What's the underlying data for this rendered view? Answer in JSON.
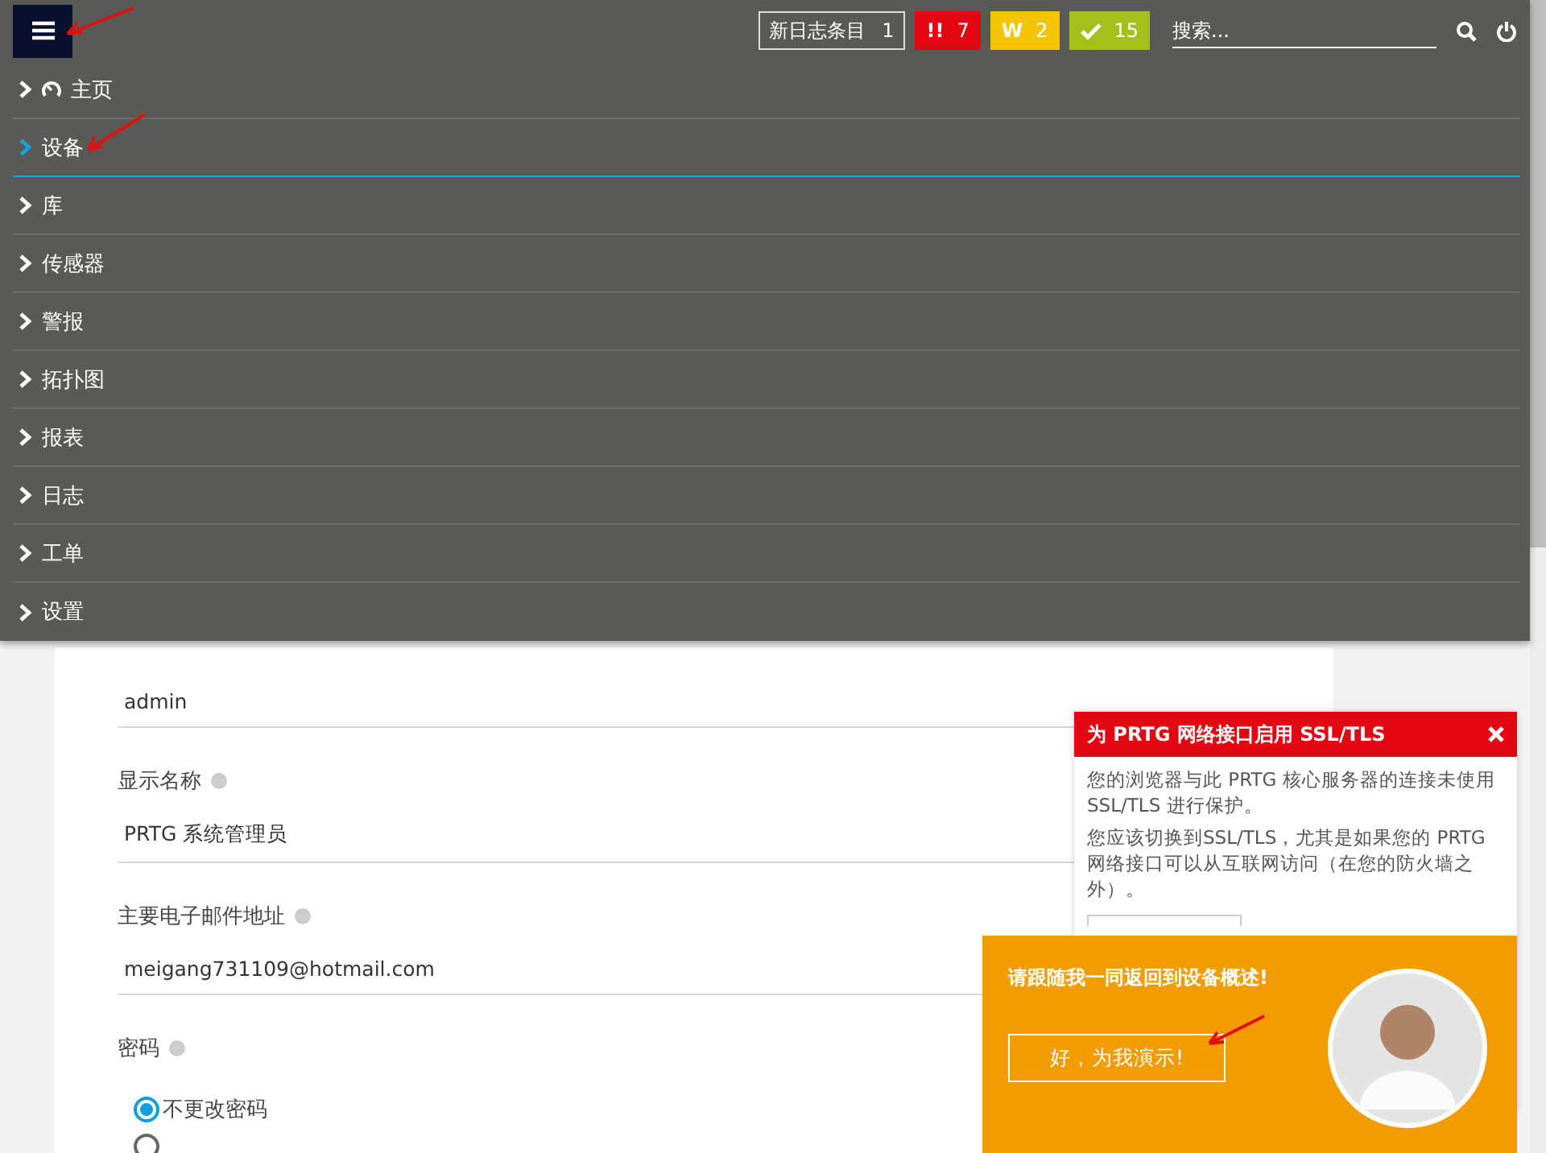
{
  "topbar": {
    "new_log": {
      "label": "新日志条目",
      "count": "1"
    },
    "alerts": [
      {
        "kind": "error",
        "symbol": "!!",
        "count": "7",
        "color": "#e30613"
      },
      {
        "kind": "warning",
        "symbol": "W",
        "count": "2",
        "color": "#f5c400"
      },
      {
        "kind": "ok",
        "count": "15",
        "color": "#a5bf1d"
      }
    ],
    "search": {
      "placeholder": "搜索..."
    }
  },
  "menu": {
    "items": [
      {
        "label": "主页",
        "kind": "home",
        "selected": false
      },
      {
        "label": "设备",
        "kind": "plain",
        "selected": true
      },
      {
        "label": "库",
        "kind": "plain",
        "selected": false
      },
      {
        "label": "传感器",
        "kind": "plain",
        "selected": false
      },
      {
        "label": "警报",
        "kind": "plain",
        "selected": false
      },
      {
        "label": "拓扑图",
        "kind": "plain",
        "selected": false
      },
      {
        "label": "报表",
        "kind": "plain",
        "selected": false
      },
      {
        "label": "日志",
        "kind": "plain",
        "selected": false
      },
      {
        "label": "工单",
        "kind": "plain",
        "selected": false
      },
      {
        "label": "设置",
        "kind": "plain",
        "selected": false
      }
    ]
  },
  "form": {
    "fields": [
      {
        "value": "admin"
      },
      {
        "label": "显示名称",
        "value": "PRTG 系统管理员"
      },
      {
        "label": "主要电子邮件地址",
        "value": "meigang731109@hotmail.com"
      }
    ],
    "password": {
      "label": "密码",
      "options": [
        {
          "label": "不更改密码",
          "selected": true
        },
        {
          "selected": false
        }
      ]
    }
  },
  "ssl_notice": {
    "title": "为 PRTG 网络接口启用 SSL/TLS",
    "paragraphs": [
      "您的浏览器与此 PRTG 核心服务器的连接未使用 SSL/TLS 进行保护。",
      "您应该切换到SSL/TLS，尤其是如果您的 PRTG 网络接口可以从互联网访问（在您的防火墙之外）。"
    ]
  },
  "tour": {
    "message": "请跟随我一同返回到设备概述!",
    "button": "好，为我演示!"
  }
}
